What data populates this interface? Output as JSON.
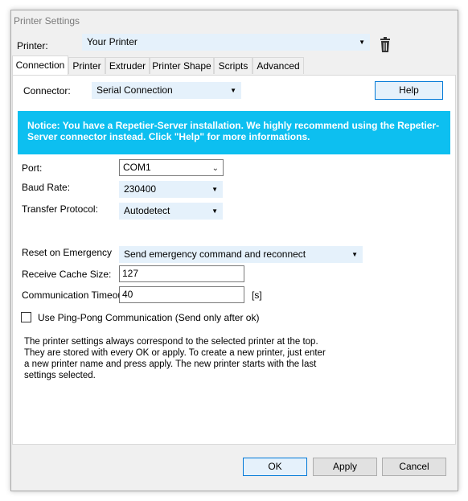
{
  "window": {
    "title": "Printer Settings"
  },
  "printer": {
    "label": "Printer:",
    "selected": "Your Printer"
  },
  "tabs": [
    "Connection",
    "Printer",
    "Extruder",
    "Printer Shape",
    "Scripts",
    "Advanced"
  ],
  "connection": {
    "connector_label": "Connector:",
    "connector_value": "Serial Connection",
    "help_button": "Help",
    "notice": "Notice: You have a Repetier-Server installation. We highly recommend using the Repetier-Server connector instead. Click \"Help\" for more informations.",
    "port_label": "Port:",
    "port_value": "COM1",
    "baud_label": "Baud Rate:",
    "baud_value": "230400",
    "protocol_label": "Transfer Protocol:",
    "protocol_value": "Autodetect",
    "reset_label": "Reset on Emergency",
    "reset_value": "Send emergency command and reconnect",
    "cache_label": "Receive Cache Size:",
    "cache_value": "127",
    "timeout_label": "Communication Timeout:",
    "timeout_value": "40",
    "timeout_unit": "[s]",
    "pingpong_label": "Use Ping-Pong Communication (Send only after ok)",
    "info_text": "The printer settings always correspond to the selected printer at the top. They are stored with every OK or apply. To create a new printer, just enter a new printer name and press apply. The new printer starts with the last settings selected."
  },
  "footer": {
    "ok": "OK",
    "apply": "Apply",
    "cancel": "Cancel"
  },
  "colors": {
    "notice_bg": "#0dbff0",
    "accent": "#0078d7",
    "combo_bg": "#e5f1fb"
  }
}
